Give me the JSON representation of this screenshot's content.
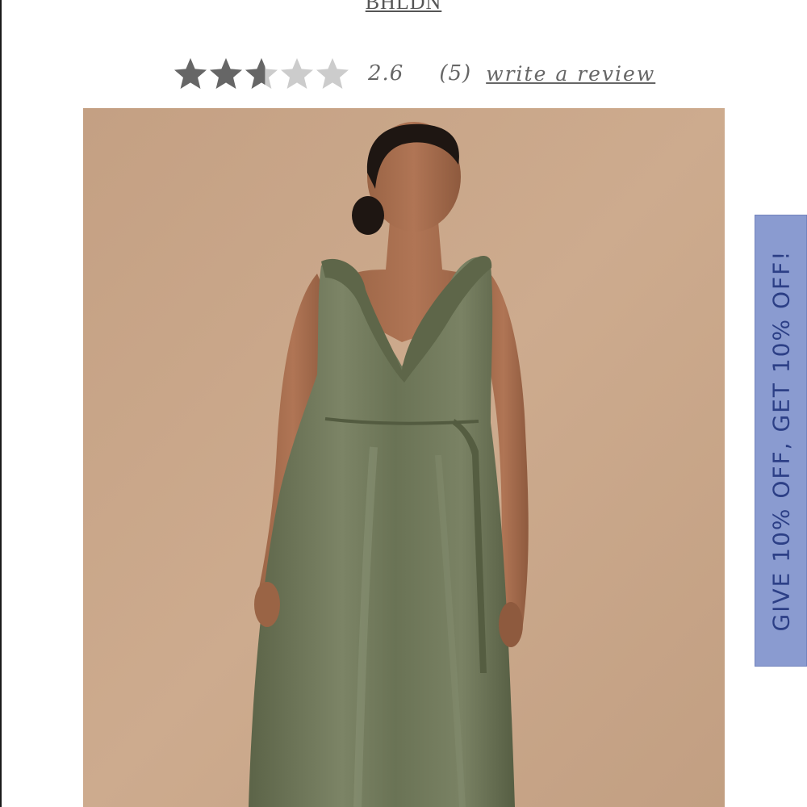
{
  "brand": {
    "name": "BHLDN"
  },
  "rating": {
    "stars_filled": 2.6,
    "stars_total": 5,
    "value": "2.6",
    "count": "(5)",
    "review_link": "write a review",
    "star_filled_color": "#666666",
    "star_empty_color": "#cccccc"
  },
  "product": {
    "image_icon": "product-photo",
    "dress_color": "#6b7355",
    "backdrop_color": "#c9a688"
  },
  "promo": {
    "text": "GIVE 10% OFF, GET 10% OFF!",
    "background": "#8a9bd0",
    "text_color": "#2c3f86"
  }
}
